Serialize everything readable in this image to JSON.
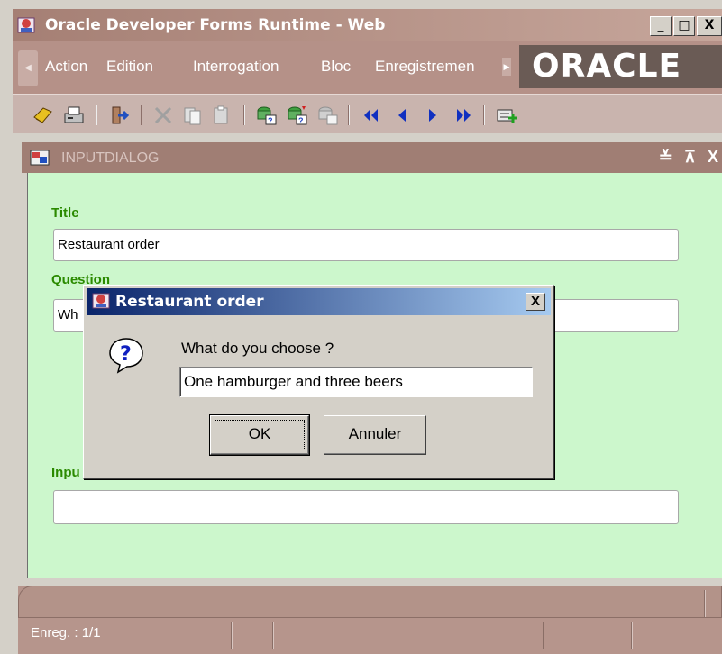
{
  "window": {
    "title": "Oracle Developer Forms Runtime - Web",
    "minimize": "_",
    "maximize": "□",
    "close": "X"
  },
  "menu": {
    "items": [
      "Action",
      "Edition",
      "Interrogation",
      "Bloc",
      "Enregistremen"
    ],
    "logo": "ORACLE"
  },
  "toolbar": {
    "icons": [
      "save-icon",
      "print-icon",
      "exit-icon",
      "cut-icon",
      "copy-icon",
      "paste-icon",
      "enter-query-icon",
      "execute-query-icon",
      "cancel-query-icon",
      "first-record-icon",
      "previous-record-icon",
      "next-record-icon",
      "last-record-icon",
      "insert-record-icon"
    ]
  },
  "form": {
    "title": "INPUTDIALOG",
    "controls": "≚ ⊼ X",
    "title_label": "Title",
    "title_value": "Restaurant order",
    "question_label": "Question",
    "question_value": "Wh",
    "input_label": "Inpu",
    "input_value": ""
  },
  "dialog": {
    "title": "Restaurant order",
    "close": "X",
    "prompt": "What do you choose ?",
    "value": "One hamburger and three beers",
    "ok": "OK",
    "cancel": "Annuler"
  },
  "status": {
    "record": "Enreg. : 1/1"
  },
  "colors": {
    "canvas": "#ccf7cc",
    "label": "#2b8a00",
    "chrome": "#b59188",
    "dialog_title": "#0a246a"
  }
}
